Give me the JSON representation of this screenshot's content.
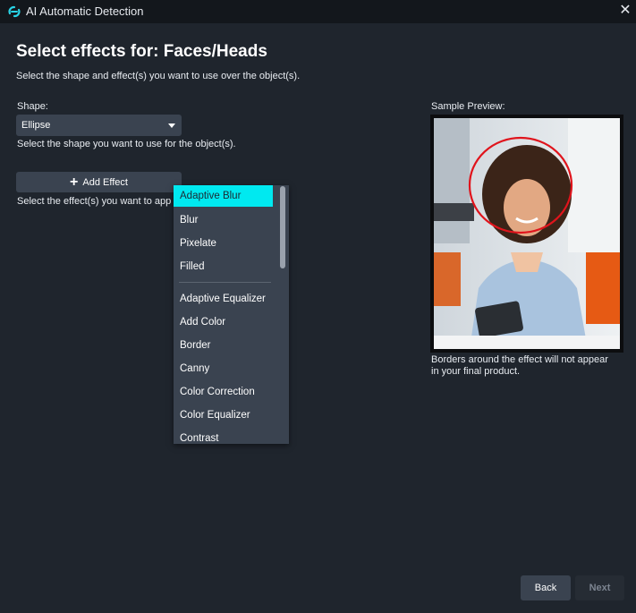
{
  "window": {
    "title": "AI Automatic Detection",
    "close_glyph": "✕"
  },
  "header": {
    "title": "Select effects for: Faces/Heads",
    "subtitle": "Select the shape and effect(s) you want to use over the object(s)."
  },
  "shape": {
    "label": "Shape:",
    "selected": "Ellipse",
    "help": "Select the shape you want to use for the object(s)."
  },
  "effects": {
    "add_button_label": "Add Effect",
    "help": "Select the effect(s) you want to app",
    "dropdown": {
      "top_items": [
        "Adaptive Blur",
        "Blur",
        "Pixelate",
        "Filled"
      ],
      "other_items": [
        "Adaptive Equalizer",
        "Add Color",
        "Border",
        "Canny",
        "Color Correction",
        "Color Equalizer",
        "Contrast"
      ],
      "highlight_color": "#00e9f0"
    }
  },
  "preview": {
    "label": "Sample Preview:",
    "note": "Borders around the effect will not appear in your final product.",
    "ellipse_color": "#e0141c"
  },
  "footer": {
    "back_label": "Back",
    "next_label": "Next"
  },
  "colors": {
    "background": "#1f252d",
    "panel": "#3a4350",
    "titlebar": "#13171c"
  }
}
